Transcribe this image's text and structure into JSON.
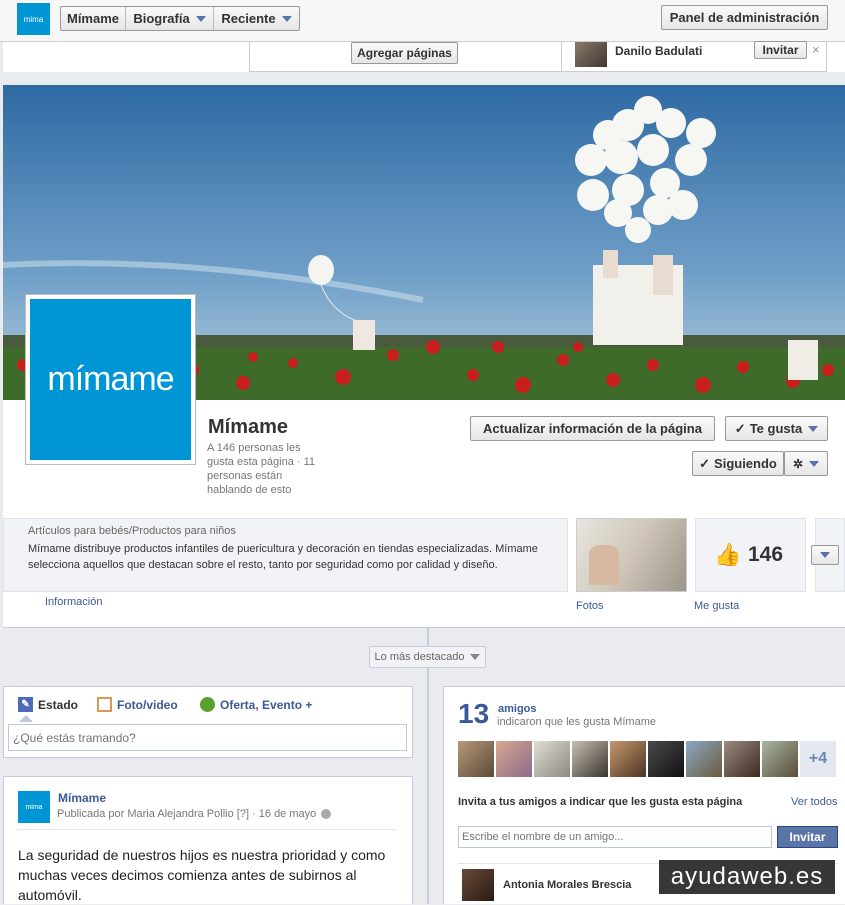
{
  "topbar": {
    "logo": "mima",
    "nav": [
      "Mímame",
      "Biografía",
      "Reciente"
    ],
    "admin": "Panel de administración"
  },
  "admin": {
    "add_pages": "Agregar páginas",
    "suggest_name": "Danilo Badulati",
    "invite": "Invitar",
    "close": "×"
  },
  "page": {
    "logo_text": "mímame",
    "name": "Mímame",
    "stats": "A 146 personas les gusta esta página · 11 personas están hablando de esto",
    "update_btn": "Actualizar información de la página",
    "like_btn": "Te gusta",
    "following_btn": "Siguiendo",
    "check": "✓"
  },
  "about": {
    "category": "Artículos para bebés/Productos para niños",
    "description": "Mímame distribuye productos infantiles de puericultura y decoración en tiendas especializadas. Mímame selecciona aquellos que destacan sobre el resto, tanto por seguridad como por calidad y diseño.",
    "info_label": "Información",
    "photos_label": "Fotos",
    "likes_label": "Me gusta",
    "likes_count": "146"
  },
  "highlight": "Lo más destacado",
  "composer": {
    "tabs": [
      "Estado",
      "Foto/video",
      "Oferta, Evento +"
    ],
    "placeholder": "¿Qué estás tramando?"
  },
  "post": {
    "author": "Mímame",
    "meta": "Publicada por Maria Alejandra Pollio [?] · 16 de mayo",
    "text": "La seguridad de nuestros hijos es nuestra prioridad y como muchas veces decimos comienza antes de subirnos al automóvil.",
    "avatar_text": "mima"
  },
  "friends": {
    "count": "13",
    "label": "amigos",
    "sub": "indicaron que les gusta Mímame",
    "more": "+4",
    "invite_title": "Invita a tus amigos a indicar que les gusta esta página",
    "see_all": "Ver todos",
    "input_placeholder": "Escribe el nombre de un amigo...",
    "invite_btn": "Invitar",
    "suggest": "Antonia Morales Brescia"
  },
  "watermark": "ayudaweb.es",
  "colors": {
    "brand": "#0096d6",
    "fb_blue": "#3b5998",
    "sky": "#4f86b8",
    "poppy": "#c81e1e"
  }
}
